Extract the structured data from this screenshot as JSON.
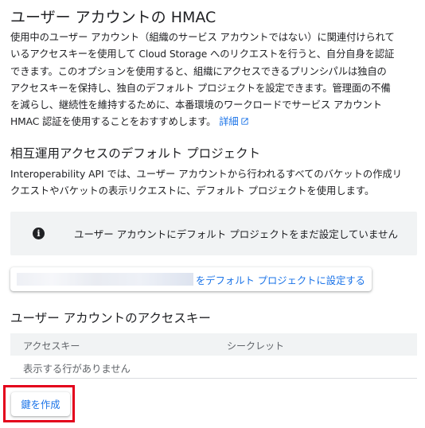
{
  "page_title": "ユーザー アカウントの HMAC",
  "description": {
    "lines": [
      "使用中のユーザー アカウント（組織のサービス アカウントではない）に関連付けられて",
      "いるアクセスキーを使用して Cloud Storage へのリクエストを行うと、自分自身を認証",
      "できます。このオプションを使用すると、組織にアクセスできるプリンシパルは独自の",
      "アクセスキーを保持し、独自のデフォルト プロジェクトを設定できます。管理面の不備",
      "を減らし、継続性を維持するために、本番環境のワークロードでサービス アカウント"
    ],
    "last_line": "HMAC 認証を使用することをおすすめします。",
    "learn_more_link": "詳細"
  },
  "interop_section": {
    "heading": "相互運用アクセスのデフォルト プロジェクト",
    "lines": [
      "Interoperability API では、ユーザー アカウントから行われるすべてのバケットの作成リ",
      "クエストやバケットの表示リクエストに、デフォルト プロジェクトを使用します。"
    ],
    "info_message": "ユーザー アカウントにデフォルト プロジェクトをまだ設定していません",
    "set_default_label": "をデフォルト プロジェクトに設定する"
  },
  "access_keys_section": {
    "heading": "ユーザー アカウントのアクセスキー",
    "columns": [
      "アクセスキー",
      "シークレット"
    ],
    "empty_text": "表示する行がありません",
    "create_key_label": "鍵を作成"
  },
  "colors": {
    "link": "#1a73e8",
    "highlight_border": "#e3001b",
    "info_bg": "#f1f3f4"
  },
  "icons": {
    "info": "info-icon",
    "external_link": "external-link-icon"
  }
}
